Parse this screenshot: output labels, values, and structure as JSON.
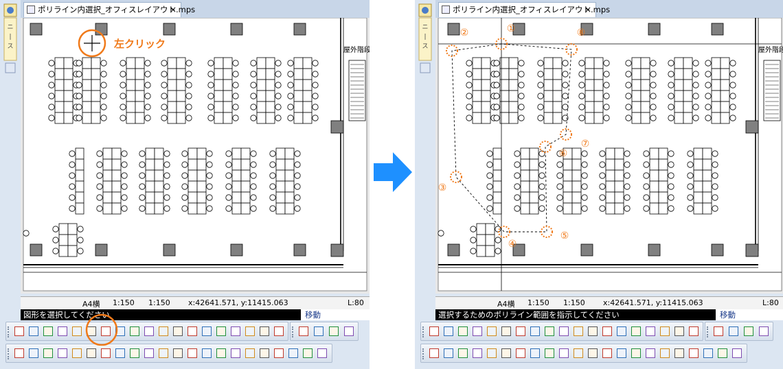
{
  "before": {
    "tab_title": "ポリライン内選択_オフィスレイアウト.mps",
    "close_symbol": "×",
    "annotation_label": "左クリック",
    "drawing_label": "屋外階段",
    "status": {
      "paper": "A4横",
      "scale1": "1:150",
      "scale2": "1:150",
      "coords": "x:42641.571, y:11415.063",
      "layer": "L:80"
    },
    "command_prompt": "図形を選択してください",
    "command_mode": "移動"
  },
  "after": {
    "tab_title": "ポリライン内選択_オフィスレイアウト.mps",
    "close_symbol": "×",
    "drawing_label": "屋外階段",
    "status": {
      "paper": "A4横",
      "scale1": "1:150",
      "scale2": "1:150",
      "coords": "x:42641.571, y:11415.063",
      "layer": "L:80"
    },
    "command_prompt": "選択するためのポリライン範囲を指示してください",
    "command_mode": "移動",
    "vertex_labels": [
      "①",
      "②",
      "③",
      "④",
      "⑤",
      "⑥",
      "⑦",
      "⑧"
    ]
  },
  "colors": {
    "accent": "#f07a1a",
    "arrow": "#1e90ff",
    "prompt_bg": "#000000"
  }
}
